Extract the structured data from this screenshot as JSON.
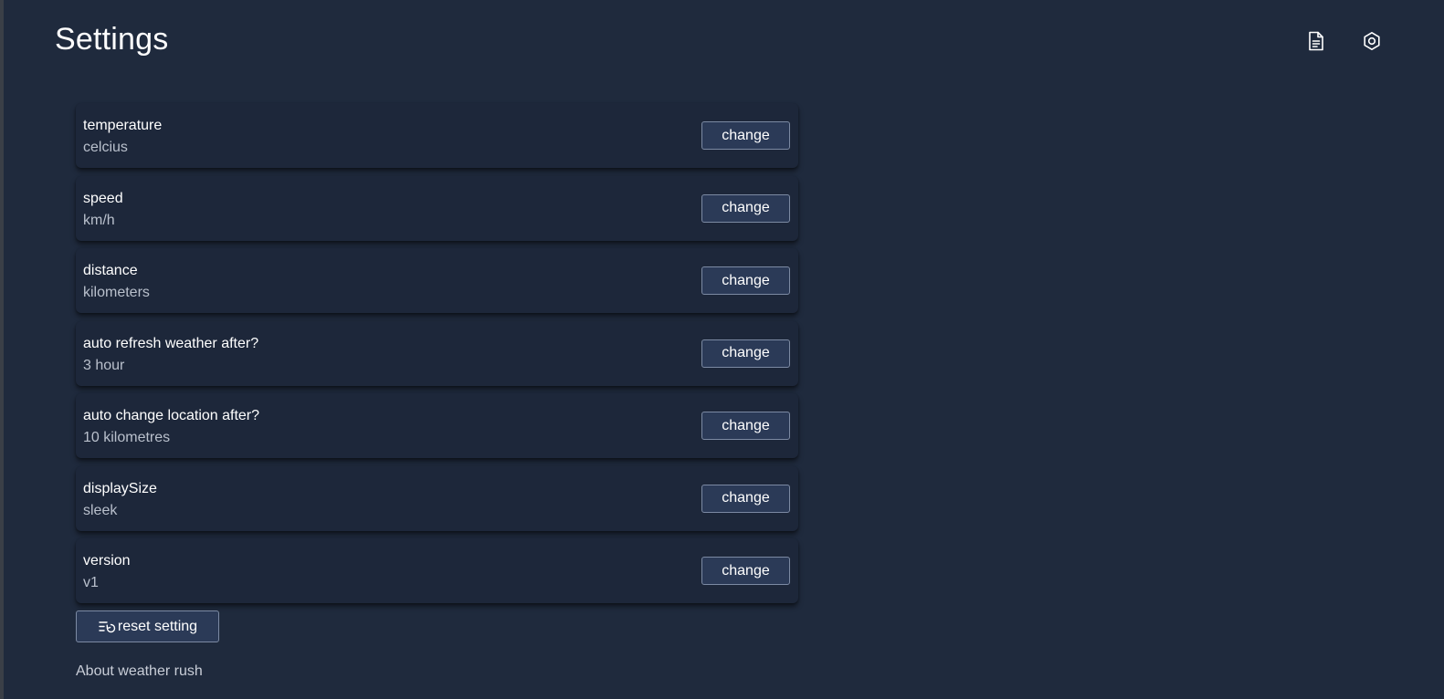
{
  "header": {
    "title": "Settings",
    "icons": [
      {
        "name": "document-icon"
      },
      {
        "name": "settings-gear-icon"
      }
    ]
  },
  "settings": [
    {
      "name": "temperature",
      "value": "celcius",
      "button_label": "change"
    },
    {
      "name": "speed",
      "value": "km/h",
      "button_label": "change"
    },
    {
      "name": "distance",
      "value": "kilometers",
      "button_label": "change"
    },
    {
      "name": "auto refresh weather after?",
      "value": "3 hour",
      "button_label": "change"
    },
    {
      "name": "auto change location after?",
      "value": "10 kilometres",
      "button_label": "change"
    },
    {
      "name": "displaySize",
      "value": "sleek",
      "button_label": "change"
    },
    {
      "name": "version",
      "value": "v1",
      "button_label": "change"
    }
  ],
  "reset": {
    "label": "reset setting",
    "icon": "reset-list-icon"
  },
  "about": {
    "label": "About weather rush"
  },
  "colors": {
    "background": "#1f2a3d",
    "card": "#1d273a",
    "button": "#2b3a57",
    "button_border": "#7c8aa3"
  }
}
